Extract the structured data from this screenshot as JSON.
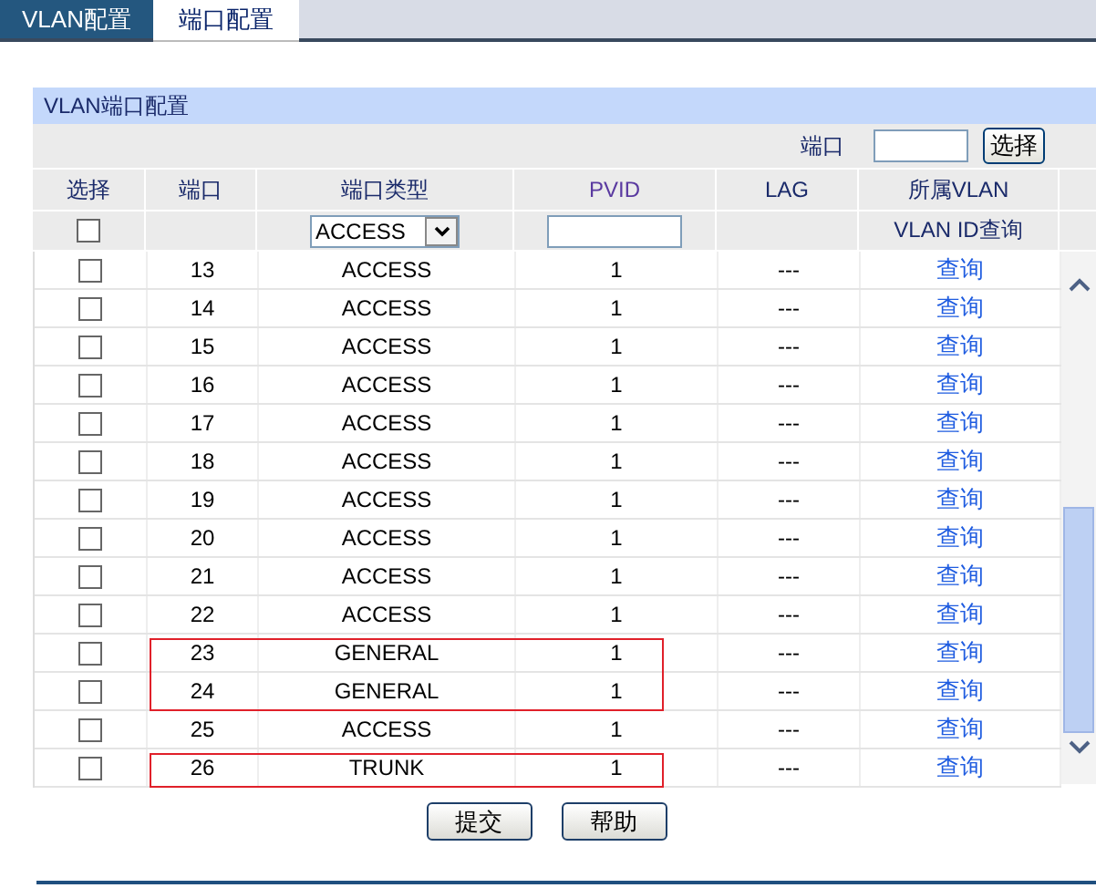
{
  "tabs": [
    {
      "label": "VLAN配置",
      "selected": false
    },
    {
      "label": "端口配置",
      "selected": true
    }
  ],
  "panel": {
    "title": "VLAN端口配置",
    "port_search": {
      "label": "端口",
      "button": "选择"
    },
    "columns": [
      "选择",
      "端口",
      "端口类型",
      "PVID",
      "LAG",
      "所属VLAN"
    ],
    "filter": {
      "checked": false,
      "type_value": "ACCESS",
      "vlan_query_label": "VLAN ID查询"
    },
    "rows": [
      {
        "checked": false,
        "port": "13",
        "type": "ACCESS",
        "pvid": "1",
        "lag": "---",
        "link": "查询",
        "marked": false
      },
      {
        "checked": false,
        "port": "14",
        "type": "ACCESS",
        "pvid": "1",
        "lag": "---",
        "link": "查询",
        "marked": false
      },
      {
        "checked": false,
        "port": "15",
        "type": "ACCESS",
        "pvid": "1",
        "lag": "---",
        "link": "查询",
        "marked": false
      },
      {
        "checked": false,
        "port": "16",
        "type": "ACCESS",
        "pvid": "1",
        "lag": "---",
        "link": "查询",
        "marked": false
      },
      {
        "checked": false,
        "port": "17",
        "type": "ACCESS",
        "pvid": "1",
        "lag": "---",
        "link": "查询",
        "marked": false
      },
      {
        "checked": false,
        "port": "18",
        "type": "ACCESS",
        "pvid": "1",
        "lag": "---",
        "link": "查询",
        "marked": false
      },
      {
        "checked": false,
        "port": "19",
        "type": "ACCESS",
        "pvid": "1",
        "lag": "---",
        "link": "查询",
        "marked": false
      },
      {
        "checked": false,
        "port": "20",
        "type": "ACCESS",
        "pvid": "1",
        "lag": "---",
        "link": "查询",
        "marked": false
      },
      {
        "checked": false,
        "port": "21",
        "type": "ACCESS",
        "pvid": "1",
        "lag": "---",
        "link": "查询",
        "marked": false
      },
      {
        "checked": false,
        "port": "22",
        "type": "ACCESS",
        "pvid": "1",
        "lag": "---",
        "link": "查询",
        "marked": false
      },
      {
        "checked": false,
        "port": "23",
        "type": "GENERAL",
        "pvid": "1",
        "lag": "---",
        "link": "查询",
        "marked": true
      },
      {
        "checked": false,
        "port": "24",
        "type": "GENERAL",
        "pvid": "1",
        "lag": "---",
        "link": "查询",
        "marked": true
      },
      {
        "checked": false,
        "port": "25",
        "type": "ACCESS",
        "pvid": "1",
        "lag": "---",
        "link": "查询",
        "marked": false
      },
      {
        "checked": false,
        "port": "26",
        "type": "TRUNK",
        "pvid": "1",
        "lag": "---",
        "link": "查询",
        "marked": true
      }
    ],
    "buttons": [
      "提交",
      "帮助"
    ]
  }
}
